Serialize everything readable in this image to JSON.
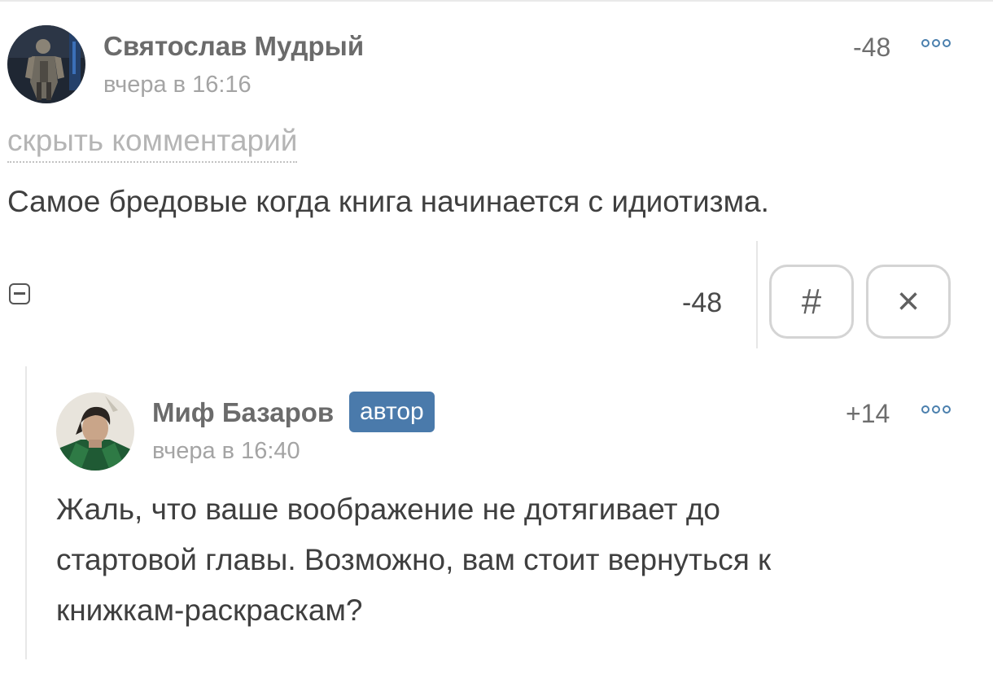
{
  "comment": {
    "author": "Святослав Мудрый",
    "time": "вчера в 16:16",
    "score": "-48",
    "hide_label": "скрыть комментарий",
    "text": "Самое бредовые когда книга начинается с идиотизма.",
    "footer_score": "-48",
    "hash_label": "#",
    "close_label": "×",
    "avatar_icon": "warrior-avatar-icon",
    "more_icon": "more-dots-icon",
    "collapse_icon": "collapse-minus-icon"
  },
  "reply": {
    "author": "Миф Базаров",
    "badge": "автор",
    "time": "вчера в 16:40",
    "score": "+14",
    "text_lines": [
      "Жаль, что ваше воображение не дотягивает до",
      "стартовой главы. Возможно, вам стоит вернуться к",
      "книжкам-раскраскам?"
    ],
    "avatar_icon": "hero-avatar-icon",
    "more_icon": "more-dots-icon"
  },
  "colors": {
    "accent": "#4a7aab",
    "author_text": "#6b6b6b",
    "muted_text": "#a4a4a4",
    "body_text": "#3f3f3f"
  }
}
